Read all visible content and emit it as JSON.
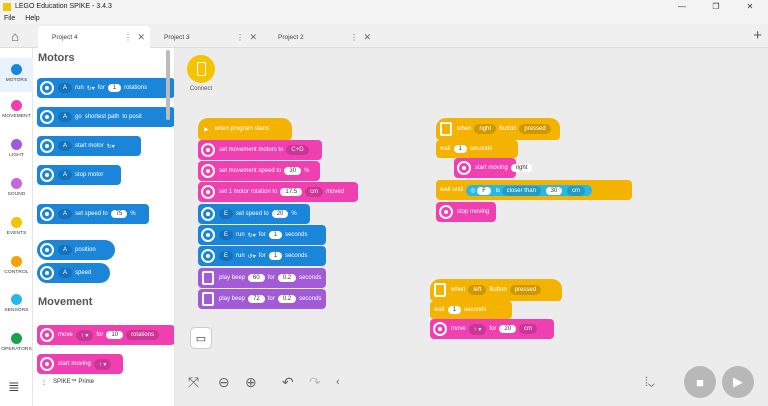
{
  "window": {
    "title": "LEGO Education SPIKE - 3.4.3"
  },
  "menu": [
    "File",
    "Help"
  ],
  "tabs": [
    {
      "label": "Project 4"
    },
    {
      "label": "Project 3"
    },
    {
      "label": "Project 2"
    }
  ],
  "categories": [
    {
      "label": "MOTORS",
      "color": "#1b86d9"
    },
    {
      "label": "MOVEMENT",
      "color": "#ef3fb0"
    },
    {
      "label": "LIGHT",
      "color": "#a25bd6"
    },
    {
      "label": "SOUND",
      "color": "#c368d8"
    },
    {
      "label": "EVENTS",
      "color": "#f5c400"
    },
    {
      "label": "CONTROL",
      "color": "#f5a300"
    },
    {
      "label": "SENSORS",
      "color": "#28b8e8"
    },
    {
      "label": "OPERATORS",
      "color": "#16a34a"
    }
  ],
  "palette": {
    "motors_heading": "Motors",
    "movement_heading": "Movement",
    "b1": {
      "port": "A",
      "run": "run",
      "for": "for",
      "val": "1",
      "tail": "rotations"
    },
    "b2": {
      "port": "A",
      "go": "go",
      "path": "shortest path",
      "tail": "to posit"
    },
    "b3": {
      "port": "A",
      "text": "start motor"
    },
    "b4": {
      "port": "A",
      "text": "stop motor"
    },
    "b5": {
      "port": "A",
      "text": "set speed to",
      "val": "75",
      "unit": "%"
    },
    "b6": {
      "port": "A",
      "text": "position"
    },
    "b7": {
      "port": "A",
      "text": "speed"
    },
    "b8": {
      "text": "move",
      "for": "for",
      "val": "10",
      "unit": "rotations"
    },
    "b9": {
      "text": "start moving"
    },
    "footer": "SPIKE™ Prime"
  },
  "connect": {
    "label": "Connect"
  },
  "stack1": {
    "hat": "when program starts",
    "s1": {
      "text": "set movement motors to",
      "val": "C+D"
    },
    "s2": {
      "text": "set movement speed to",
      "val": "30",
      "unit": "%"
    },
    "s3": {
      "text": "set 1 motor rotation to",
      "val": "17.5",
      "unit": "cm",
      "tail": "moved"
    },
    "s4": {
      "port": "E",
      "text": "set speed to",
      "val": "20",
      "unit": "%"
    },
    "s5": {
      "port": "E",
      "run": "run",
      "for": "for",
      "val": "1",
      "unit": "seconds"
    },
    "s6": {
      "port": "E",
      "run": "run",
      "for": "for",
      "val": "1",
      "unit": "seconds"
    },
    "s7": {
      "text": "play beep",
      "val": "60",
      "for": "for",
      "val2": "0.2",
      "unit": "seconds"
    },
    "s8": {
      "text": "play beep",
      "val": "72",
      "for": "for",
      "val2": "0.2",
      "unit": "seconds"
    }
  },
  "stack2": {
    "hat": {
      "when": "when",
      "btn": "right",
      "btntext": "Button",
      "state": "pressed"
    },
    "wait": {
      "text": "wait",
      "val": "1",
      "unit": "seconds"
    },
    "start": {
      "text": "start moving",
      "dir": "right"
    },
    "waituntil": {
      "text": "wait until",
      "port": "F",
      "is": "is",
      "cmp": "closer than",
      "val": "30",
      "unit": "cm"
    },
    "stop": {
      "text": "stop moving"
    }
  },
  "stack3": {
    "hat": {
      "when": "when",
      "btn": "left",
      "btntext": "Button",
      "state": "pressed"
    },
    "wait": {
      "text": "wait",
      "val": "1",
      "unit": "seconds"
    },
    "move": {
      "text": "move",
      "for": "for",
      "val": "20",
      "unit": "cm"
    }
  }
}
